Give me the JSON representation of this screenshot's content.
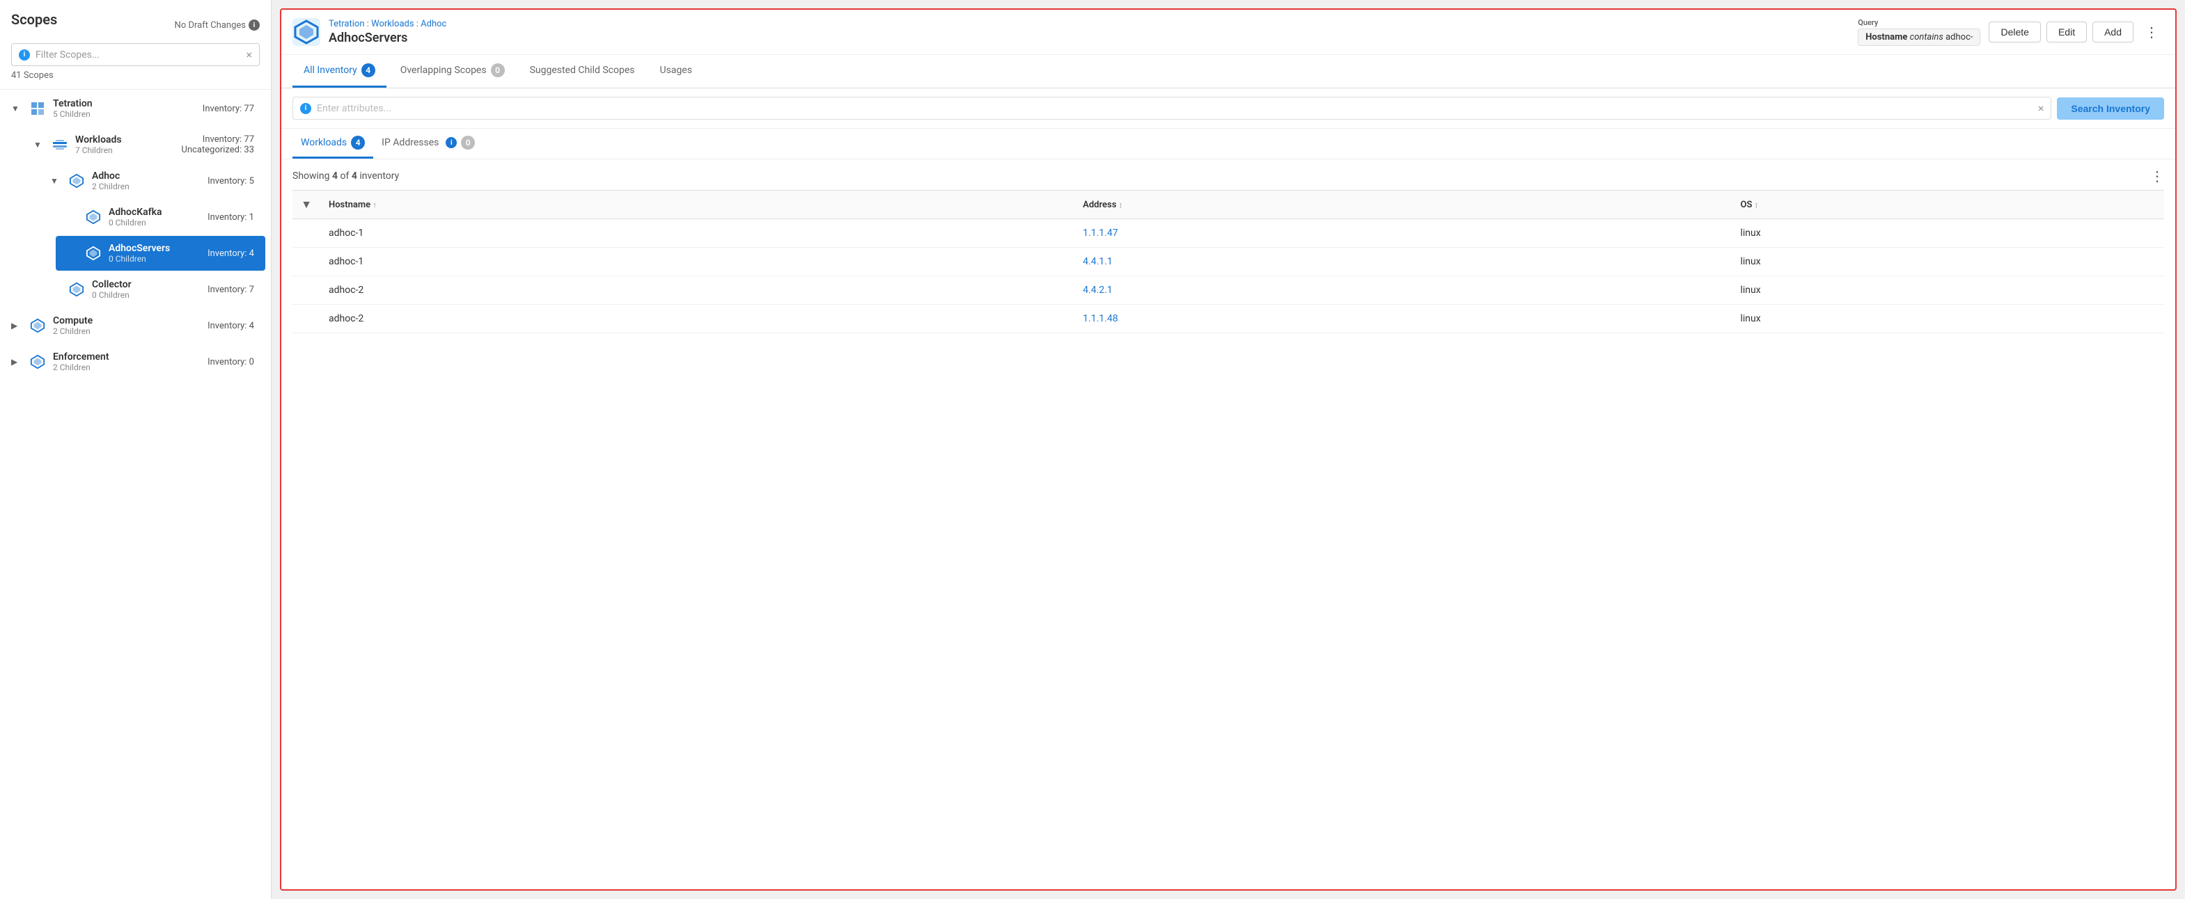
{
  "sidebar": {
    "title": "Scopes",
    "draft_changes": "No Draft Changes",
    "filter_placeholder": "Filter Scopes...",
    "scope_count": "41 Scopes",
    "scopes": [
      {
        "id": "tetration",
        "name": "Tetration",
        "children_count": "5 Children",
        "inventory": "Inventory: 77",
        "expanded": true,
        "level": 0,
        "has_grid_icon": true,
        "children": [
          {
            "id": "workloads",
            "name": "Workloads",
            "children_count": "7 Children",
            "inventory_line1": "Inventory: 77",
            "inventory_line2": "Uncategorized: 33",
            "expanded": true,
            "level": 1,
            "children": [
              {
                "id": "adhoc",
                "name": "Adhoc",
                "children_count": "2 Children",
                "inventory": "Inventory: 5",
                "expanded": true,
                "level": 2,
                "children": [
                  {
                    "id": "adhockafka",
                    "name": "AdhocKafka",
                    "children_count": "0 Children",
                    "inventory": "Inventory: 1",
                    "expanded": false,
                    "level": 3,
                    "active": false
                  },
                  {
                    "id": "adhocservers",
                    "name": "AdhocServers",
                    "children_count": "0 Children",
                    "inventory": "Inventory: 4",
                    "expanded": false,
                    "level": 3,
                    "active": true
                  }
                ]
              },
              {
                "id": "collector",
                "name": "Collector",
                "children_count": "0 Children",
                "inventory": "Inventory: 7",
                "level": 2,
                "active": false
              }
            ]
          }
        ]
      },
      {
        "id": "compute",
        "name": "Compute",
        "children_count": "2 Children",
        "inventory": "Inventory: 4",
        "level": 0,
        "active": false
      },
      {
        "id": "enforcement",
        "name": "Enforcement",
        "children_count": "2 Children",
        "inventory": "Inventory: 0",
        "level": 0,
        "active": false
      }
    ]
  },
  "detail": {
    "breadcrumb": {
      "parts": [
        "Tetration",
        "Workloads",
        "Adhoc"
      ],
      "separator": ":"
    },
    "name": "AdhocServers",
    "query_label": "Query",
    "query_value": "Hostname contains adhoc-",
    "actions": {
      "delete": "Delete",
      "edit": "Edit",
      "add": "Add"
    },
    "tabs": [
      {
        "id": "all-inventory",
        "label": "All Inventory",
        "badge": "4",
        "badge_type": "blue",
        "active": true
      },
      {
        "id": "overlapping-scopes",
        "label": "Overlapping Scopes",
        "badge": "0",
        "badge_type": "gray",
        "active": false
      },
      {
        "id": "suggested-child-scopes",
        "label": "Suggested Child Scopes",
        "badge": null,
        "active": false
      },
      {
        "id": "usages",
        "label": "Usages",
        "badge": null,
        "active": false
      }
    ],
    "search_placeholder": "Enter attributes...",
    "search_btn": "Search Inventory",
    "subtabs": [
      {
        "id": "workloads",
        "label": "Workloads",
        "badge": "4",
        "badge_type": "blue",
        "active": true
      },
      {
        "id": "ip-addresses",
        "label": "IP Addresses",
        "badge": "0",
        "badge_type": "gray",
        "active": false
      }
    ],
    "showing_text": "Showing",
    "showing_count": "4",
    "showing_of": "of",
    "showing_total": "4",
    "showing_suffix": "inventory",
    "table": {
      "columns": [
        {
          "id": "filter",
          "label": ""
        },
        {
          "id": "hostname",
          "label": "Hostname",
          "sort": "asc"
        },
        {
          "id": "address",
          "label": "Address",
          "sort": "both"
        },
        {
          "id": "os",
          "label": "OS",
          "sort": "both"
        }
      ],
      "rows": [
        {
          "hostname": "adhoc-1",
          "address": "1.1.1.47",
          "os": "linux"
        },
        {
          "hostname": "adhoc-1",
          "address": "4.4.1.1",
          "os": "linux"
        },
        {
          "hostname": "adhoc-2",
          "address": "4.4.2.1",
          "os": "linux"
        },
        {
          "hostname": "adhoc-2",
          "address": "1.1.1.48",
          "os": "linux"
        }
      ]
    }
  },
  "colors": {
    "accent": "#1976d2",
    "active_bg": "#1976d2",
    "border_highlight": "#e53935",
    "link": "#1976d2"
  }
}
